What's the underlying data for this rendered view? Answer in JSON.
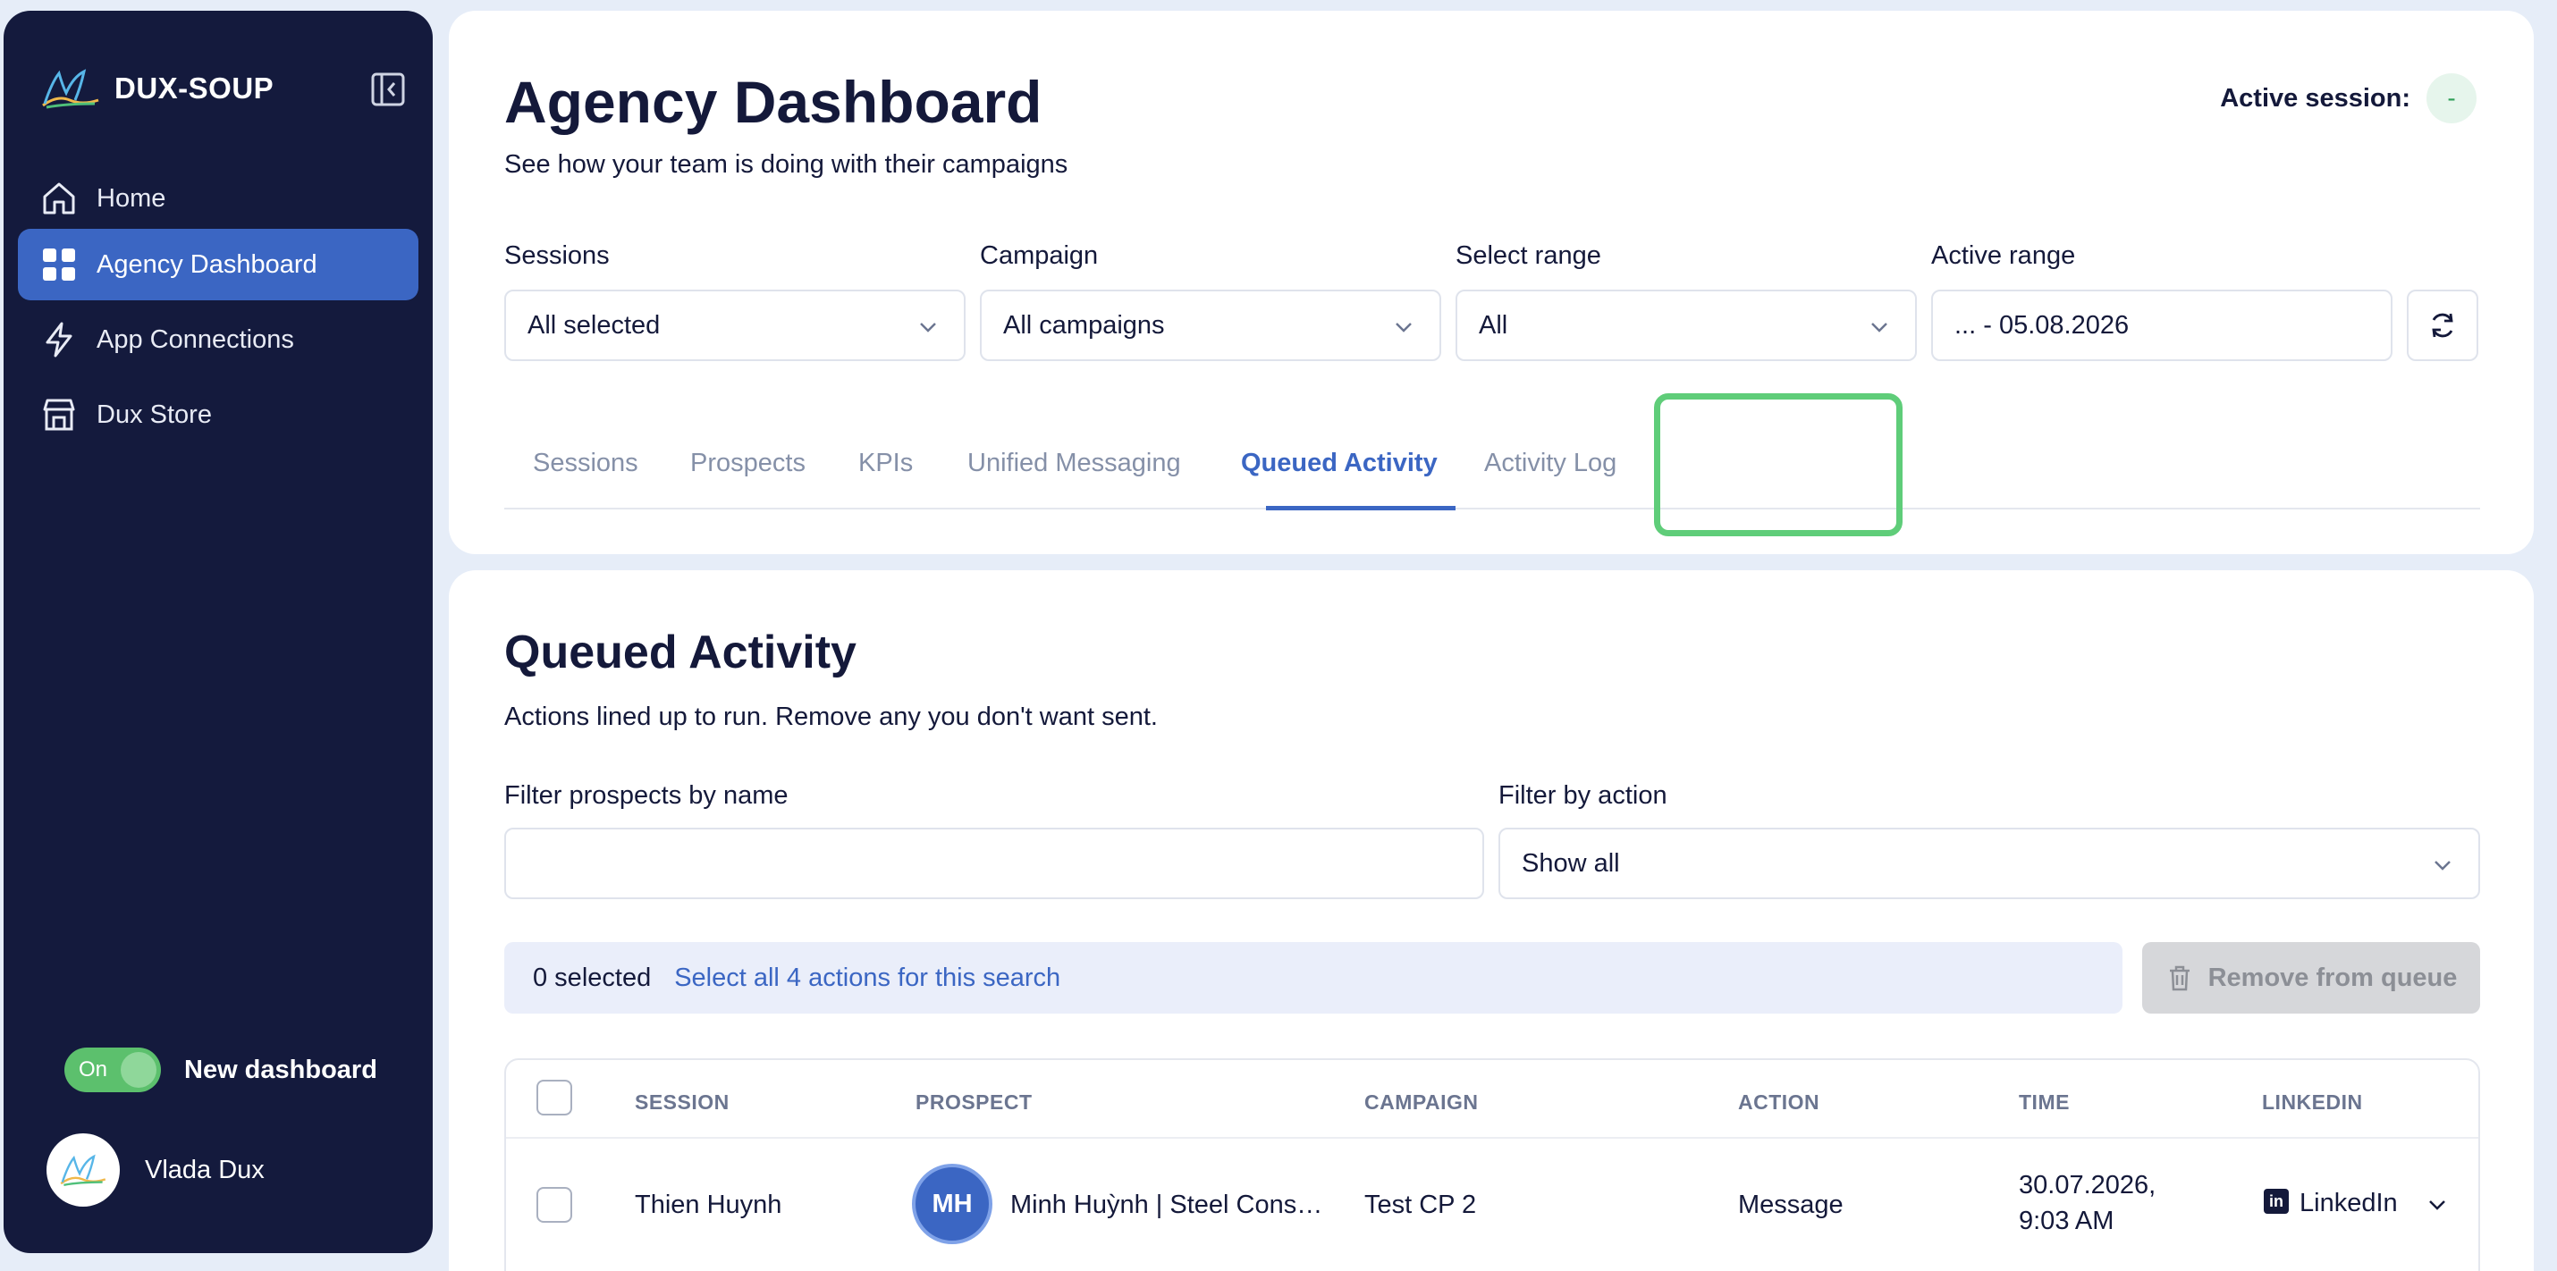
{
  "sidebar": {
    "brand": "DUX-SOUP",
    "nav": [
      {
        "label": "Home",
        "icon": "home-icon"
      },
      {
        "label": "Agency Dashboard",
        "icon": "dashboard-icon",
        "active": true
      },
      {
        "label": "App Connections",
        "icon": "lightning-icon"
      },
      {
        "label": "Dux Store",
        "icon": "store-icon"
      }
    ],
    "toggle_state": "On",
    "toggle_label": "New dashboard",
    "user_name": "Vlada Dux"
  },
  "header": {
    "title": "Agency Dashboard",
    "subtitle": "See how your team is doing with their campaigns",
    "active_session_label": "Active session:",
    "active_session_value": "-"
  },
  "filters": {
    "sessions_label": "Sessions",
    "sessions_value": "All selected",
    "campaign_label": "Campaign",
    "campaign_value": "All campaigns",
    "range_label": "Select range",
    "range_value": "All",
    "active_range_label": "Active range",
    "active_range_value": "... - 05.08.2026"
  },
  "tabs": [
    {
      "label": "Sessions"
    },
    {
      "label": "Prospects"
    },
    {
      "label": "KPIs"
    },
    {
      "label": "Unified Messaging"
    },
    {
      "label": "Queued Activity",
      "active": true
    },
    {
      "label": "Activity Log"
    }
  ],
  "queued": {
    "title": "Queued Activity",
    "subtitle": "Actions lined up to run. Remove any you don't want sent.",
    "filter_name_label": "Filter prospects by name",
    "filter_name_value": "",
    "filter_action_label": "Filter by action",
    "filter_action_value": "Show all",
    "selected_text": "0 selected",
    "select_all_link": "Select all 4 actions for this search",
    "remove_button": "Remove from queue"
  },
  "table": {
    "columns": [
      "SESSION",
      "PROSPECT",
      "CAMPAIGN",
      "ACTION",
      "TIME",
      "LINKEDIN"
    ],
    "rows": [
      {
        "session": "Thien Huynh",
        "initials": "MH",
        "prospect": "Minh Huỳnh | Steel Cons…",
        "campaign": "Test CP 2",
        "action": "Message",
        "time_date": "30.07.2026,",
        "time_clock": "9:03 AM",
        "linkedin": "LinkedIn"
      }
    ]
  },
  "colors": {
    "sidebar_bg": "#141a3d",
    "accent": "#3b66c3",
    "highlight": "#5fcd79",
    "toggle_on": "#5cc06d"
  }
}
